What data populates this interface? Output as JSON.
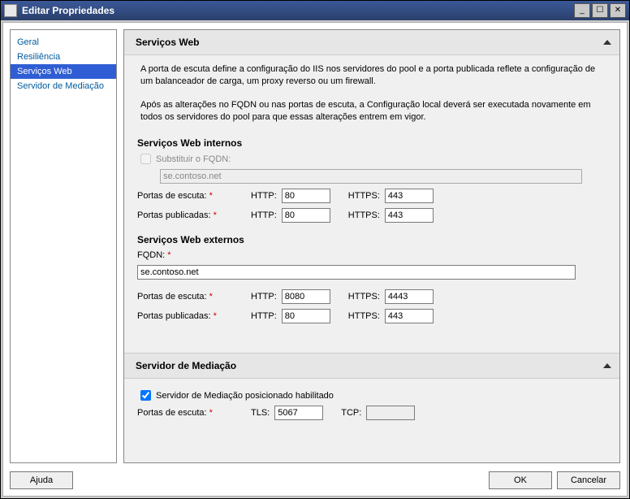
{
  "window": {
    "title": "Editar Propriedades"
  },
  "nav": {
    "items": [
      {
        "label": "Geral",
        "selected": false
      },
      {
        "label": "Resiliência",
        "selected": false
      },
      {
        "label": "Serviços Web",
        "selected": true
      },
      {
        "label": "Servidor de Mediação",
        "selected": false
      }
    ]
  },
  "section_web": {
    "title": "Serviços Web",
    "desc1": "A porta de escuta define a configuração do IIS nos servidores do pool e a porta publicada reflete a configuração de um balanceador de carga, um proxy reverso ou um firewall.",
    "desc2": "Após as alterações no FQDN ou nas portas de escuta, a Configuração local deverá ser executada novamente em todos os servidores do pool para que essas alterações entrem em vigor.",
    "internal": {
      "title": "Serviços Web internos",
      "override_label": "Substituir o FQDN:",
      "override_checked": false,
      "fqdn": "se.contoso.net",
      "listen_label": "Portas de escuta:",
      "published_label": "Portas publicadas:",
      "http_label": "HTTP:",
      "https_label": "HTTPS:",
      "listen_http": "80",
      "listen_https": "443",
      "pub_http": "80",
      "pub_https": "443"
    },
    "external": {
      "title": "Serviços Web externos",
      "fqdn_label": "FQDN:",
      "fqdn": "se.contoso.net",
      "listen_label": "Portas de escuta:",
      "published_label": "Portas publicadas:",
      "http_label": "HTTP:",
      "https_label": "HTTPS:",
      "listen_http": "8080",
      "listen_https": "4443",
      "pub_http": "80",
      "pub_https": "443"
    }
  },
  "section_mediation": {
    "title": "Servidor de Mediação",
    "enabled_label": "Servidor de Mediação posicionado habilitado",
    "enabled_checked": true,
    "listen_label": "Portas de escuta:",
    "tls_label": "TLS:",
    "tcp_label": "TCP:",
    "tls_port": "5067",
    "tcp_port": ""
  },
  "buttons": {
    "help": "Ajuda",
    "ok": "OK",
    "cancel": "Cancelar"
  },
  "req_marker": "*"
}
